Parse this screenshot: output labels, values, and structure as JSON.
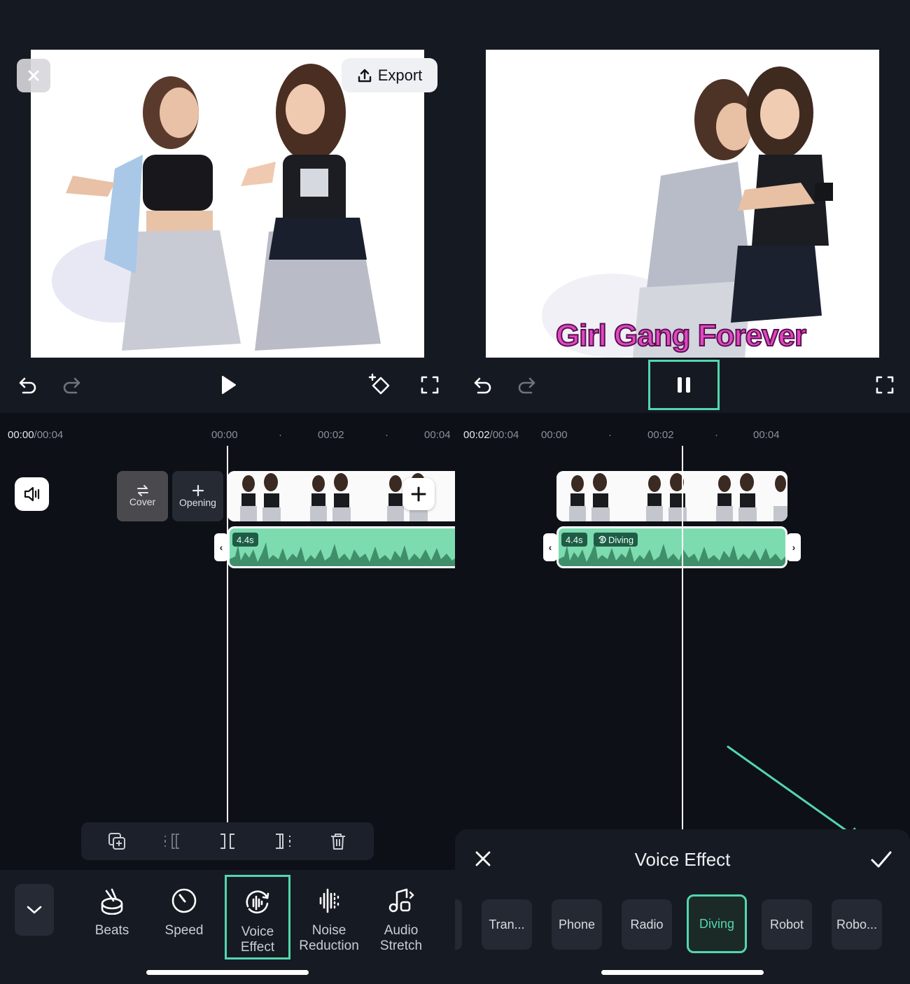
{
  "left": {
    "export_label": "Export",
    "timeline": {
      "current_time": "00:00",
      "total_time": "/00:04",
      "ticks": [
        "00:00",
        "00:02",
        "00:04"
      ]
    },
    "cover_label": "Cover",
    "opening_label": "Opening",
    "audio_duration": "4.4s",
    "tools": [
      {
        "label_1": "Beats",
        "label_2": "",
        "icon": "beats-icon"
      },
      {
        "label_1": "Speed",
        "label_2": "",
        "icon": "speed-icon"
      },
      {
        "label_1": "Voice",
        "label_2": "Effect",
        "icon": "voice-effect-icon"
      },
      {
        "label_1": "Noise",
        "label_2": "Reduction",
        "icon": "noise-reduction-icon"
      },
      {
        "label_1": "Audio",
        "label_2": "Stretch",
        "icon": "audio-stretch-icon"
      }
    ]
  },
  "right": {
    "timeline": {
      "current_time": "00:02",
      "total_time": "/00:04",
      "ticks": [
        "00:00",
        "00:02",
        "00:04"
      ]
    },
    "subtitle_text": "Girl Gang Forever",
    "audio_duration": "4.4s",
    "audio_effect_tag": "Diving",
    "voice_effect_panel": {
      "title": "Voice Effect",
      "options": [
        "Tran...",
        "Phone",
        "Radio",
        "Diving",
        "Robot",
        "Robo..."
      ],
      "selected": "Diving"
    }
  },
  "colors": {
    "accent": "#52d6ae",
    "audio_track": "#7ddbb0",
    "subtitle": "#e048c2",
    "background": "#0d1016"
  }
}
